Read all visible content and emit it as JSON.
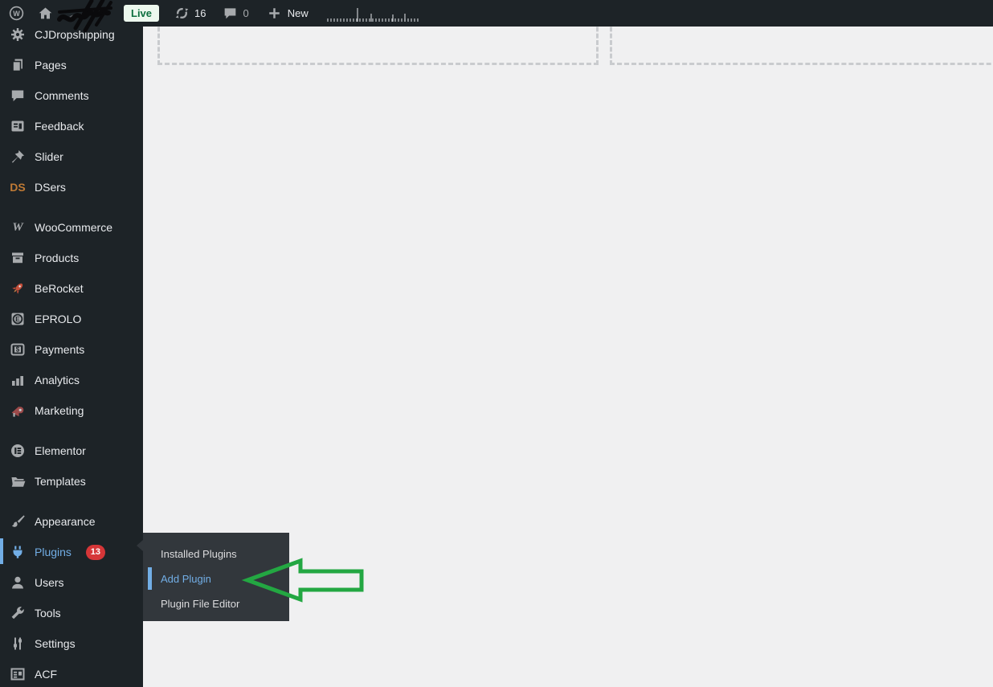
{
  "admin_bar": {
    "live_badge": "Live",
    "updates_count": "16",
    "comments_count": "0",
    "new_label": "New"
  },
  "icon_glyphs": {
    "wordpress": "W",
    "dsers": "DS",
    "woocommerce": "W",
    "eprolo": "E",
    "payments": "$"
  },
  "sidebar": {
    "items": [
      {
        "label": "CJDropshipping",
        "icon": "gear"
      },
      {
        "label": "Pages",
        "icon": "pages"
      },
      {
        "label": "Comments",
        "icon": "speech-bubble"
      },
      {
        "label": "Feedback",
        "icon": "form"
      },
      {
        "label": "Slider",
        "icon": "pushpin"
      },
      {
        "label": "DSers",
        "icon": "ds-logo"
      },
      {
        "label": "WooCommerce",
        "icon": "woo-logo"
      },
      {
        "label": "Products",
        "icon": "box"
      },
      {
        "label": "BeRocket",
        "icon": "rocket"
      },
      {
        "label": "EPROLO",
        "icon": "eprolo-logo"
      },
      {
        "label": "Payments",
        "icon": "dollar-card"
      },
      {
        "label": "Analytics",
        "icon": "bar-chart"
      },
      {
        "label": "Marketing",
        "icon": "megaphone"
      },
      {
        "label": "Elementor",
        "icon": "elementor-logo"
      },
      {
        "label": "Templates",
        "icon": "folder"
      },
      {
        "label": "Appearance",
        "icon": "paintbrush"
      },
      {
        "label": "Plugins",
        "icon": "plug",
        "badge": "13",
        "active": true
      },
      {
        "label": "Users",
        "icon": "person"
      },
      {
        "label": "Tools",
        "icon": "wrench"
      },
      {
        "label": "Settings",
        "icon": "sliders"
      },
      {
        "label": "ACF",
        "icon": "table-grid"
      }
    ]
  },
  "plugins_submenu": {
    "items": [
      {
        "label": "Installed Plugins"
      },
      {
        "label": "Add Plugin",
        "active": true
      },
      {
        "label": "Plugin File Editor"
      }
    ]
  },
  "colors": {
    "admin_bar_bg": "#1d2327",
    "sidebar_bg": "#1d2327",
    "submenu_bg": "#32373c",
    "content_bg": "#f0f0f1",
    "accent_blue": "#72aee6",
    "badge_red": "#d63638",
    "live_green": "#0d6f3f",
    "annotation_green": "#23a742",
    "dashed_border": "#c9cbce"
  }
}
